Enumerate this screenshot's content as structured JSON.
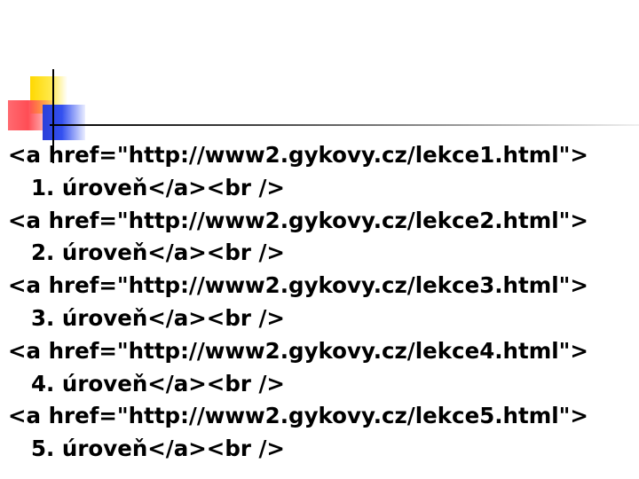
{
  "slide": {
    "entries": [
      {
        "tag": "<a href=\"http://www2.gykovy.cz/lekce1.html\">",
        "text": "1. úroveň</a><br />"
      },
      {
        "tag": "<a href=\"http://www2.gykovy.cz/lekce2.html\">",
        "text": "2. úroveň</a><br />"
      },
      {
        "tag": "<a href=\"http://www2.gykovy.cz/lekce3.html\">",
        "text": "3. úroveň</a><br />"
      },
      {
        "tag": "<a href=\"http://www2.gykovy.cz/lekce4.html\">",
        "text": "4. úroveň</a><br />"
      },
      {
        "tag": "<a href=\"http://www2.gykovy.cz/lekce5.html\">",
        "text": "5. úroveň</a><br />"
      }
    ]
  },
  "colors": {
    "yellow": "#ffd800",
    "red": "#ff4d55",
    "blue": "#3350f0",
    "text": "#000000"
  }
}
